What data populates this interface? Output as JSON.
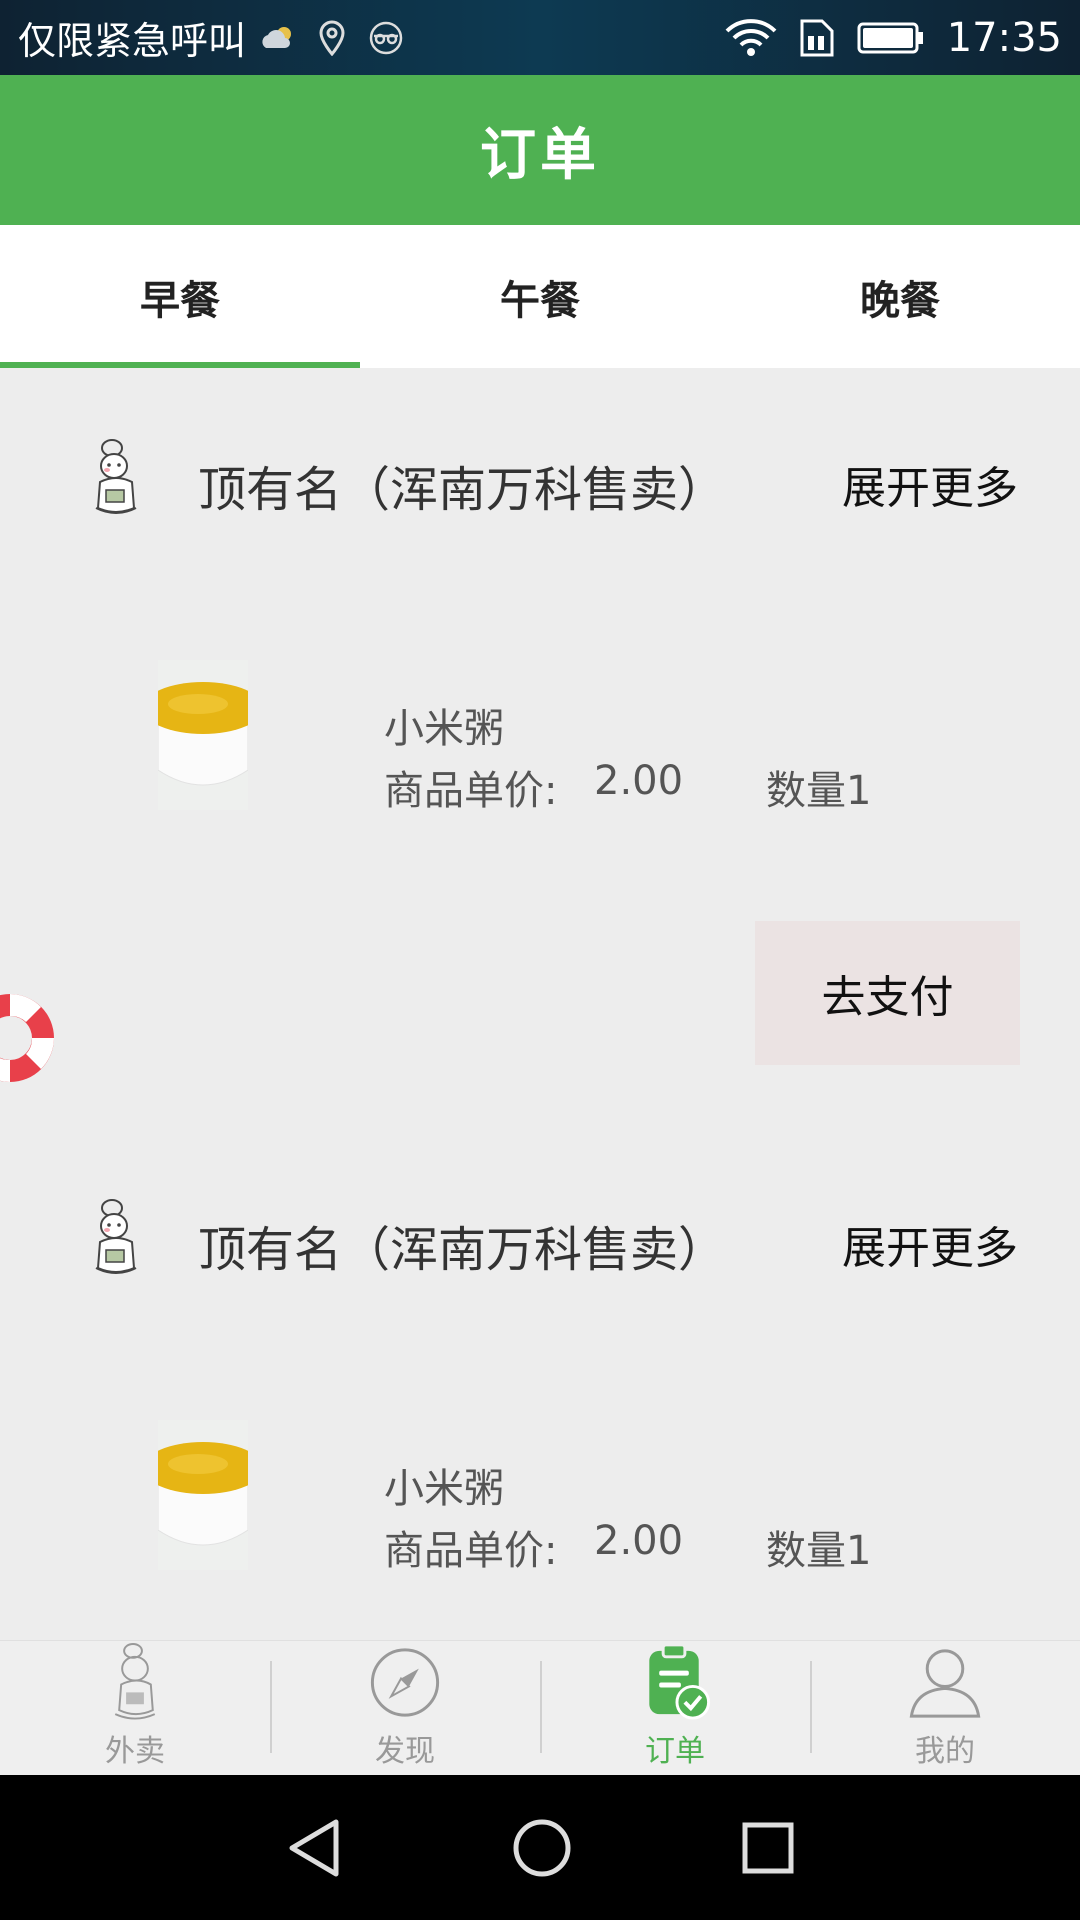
{
  "status_bar": {
    "carrier": "仅限紧急呼叫",
    "time": "17:35",
    "icons": [
      "weather-icon",
      "location-icon",
      "glasses-icon",
      "wifi-icon",
      "sim-icon",
      "battery-icon"
    ]
  },
  "header": {
    "title": "订单"
  },
  "tabs": [
    {
      "label": "早餐",
      "active": true
    },
    {
      "label": "午餐",
      "active": false
    },
    {
      "label": "晚餐",
      "active": false
    }
  ],
  "orders": [
    {
      "shop_name": "顶有名（浑南万科售卖）",
      "expand_label": "展开更多",
      "item": {
        "name": "小米粥",
        "price_label": "商品单价:",
        "price": "2.00",
        "quantity": "数量1"
      },
      "pay_label": "去支付"
    },
    {
      "shop_name": "顶有名（浑南万科售卖）",
      "expand_label": "展开更多",
      "item": {
        "name": "小米粥",
        "price_label": "商品单价:",
        "price": "2.00",
        "quantity": "数量1"
      }
    }
  ],
  "bottom_nav": [
    {
      "label": "外卖",
      "icon": "chef-icon",
      "active": false
    },
    {
      "label": "发现",
      "icon": "compass-icon",
      "active": false
    },
    {
      "label": "订单",
      "icon": "clipboard-check-icon",
      "active": true
    },
    {
      "label": "我的",
      "icon": "user-icon",
      "active": false
    }
  ],
  "colors": {
    "brand_green": "#4fb152",
    "background": "#ededed",
    "pay_button_bg": "#ebe3e3"
  }
}
